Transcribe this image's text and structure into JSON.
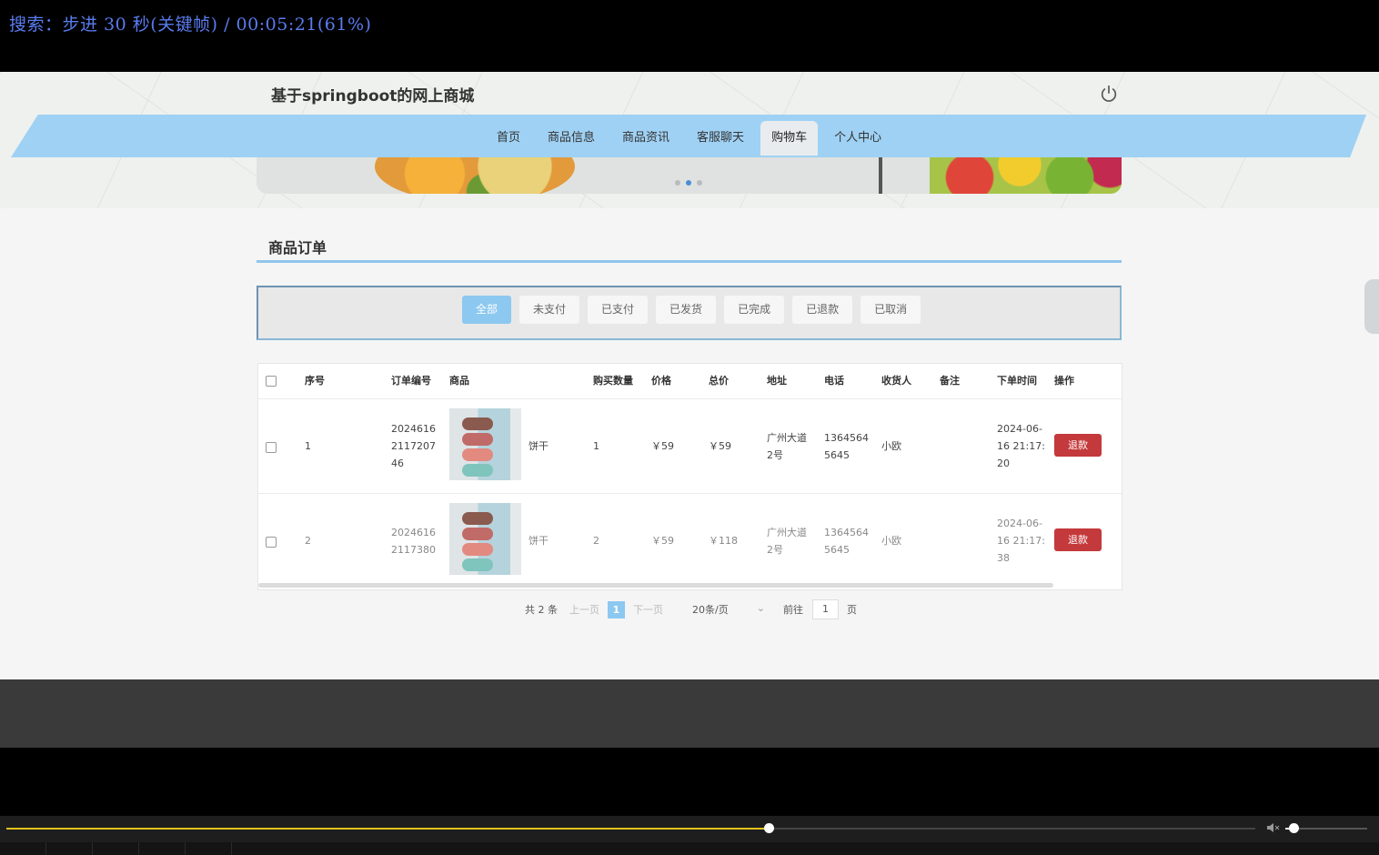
{
  "overlay": {
    "text": "搜索：步进 30 秒(关键帧) / 00:05:21(61%)"
  },
  "site": {
    "title": "基于springboot的网上商城",
    "power_icon": "power-icon"
  },
  "nav": {
    "items": [
      {
        "label": "首页"
      },
      {
        "label": "商品信息"
      },
      {
        "label": "商品资讯"
      },
      {
        "label": "客服聊天"
      },
      {
        "label": "购物车",
        "active": true
      },
      {
        "label": "个人中心"
      }
    ]
  },
  "banner": {
    "active_slide": 2,
    "total_slides": 3
  },
  "section": {
    "title": "商品订单"
  },
  "filters": [
    {
      "label": "全部",
      "active": true
    },
    {
      "label": "未支付"
    },
    {
      "label": "已支付"
    },
    {
      "label": "已发货"
    },
    {
      "label": "已完成"
    },
    {
      "label": "已退款"
    },
    {
      "label": "已取消"
    }
  ],
  "table": {
    "headers": {
      "index": "序号",
      "order_no": "订单编号",
      "product": "商品",
      "qty": "购买数量",
      "price": "价格",
      "total": "总价",
      "address": "地址",
      "phone": "电话",
      "receiver": "收货人",
      "note": "备注",
      "time": "下单时间",
      "action": "操作"
    },
    "rows": [
      {
        "index": "1",
        "order_no": [
          "2024616",
          "2117207",
          "46"
        ],
        "product": "饼干",
        "qty": "1",
        "price": "￥59",
        "total": "￥59",
        "address": [
          "广州大道",
          "2号"
        ],
        "phone": [
          "1364564",
          "5645"
        ],
        "receiver": "小欧",
        "note": "",
        "time": [
          "2024-06-",
          "16 21:17:",
          "20"
        ],
        "action": "退款"
      },
      {
        "index": "2",
        "order_no": [
          "2024616",
          "2117380"
        ],
        "product": "饼干",
        "qty": "2",
        "price": "￥59",
        "total": "￥118",
        "address": [
          "广州大道",
          "2号"
        ],
        "phone": [
          "1364564",
          "5645"
        ],
        "receiver": "小欧",
        "note": "",
        "time": [
          "2024-06-",
          "16 21:17:",
          "38"
        ],
        "action": "退款"
      }
    ]
  },
  "pagination": {
    "total": "共 2 条",
    "prev": "上一页",
    "current": "1",
    "next": "下一页",
    "page_size": "20条/页",
    "goto_label": "前往",
    "goto_value": "1",
    "page_suffix": "页"
  },
  "player": {
    "progress": 0.61,
    "volume": 0.1
  },
  "colors": {
    "accent": "#8cc8ef",
    "nav_band": "#9fd1f4",
    "refund": "#c4393b",
    "progress": "#e3c21b"
  }
}
